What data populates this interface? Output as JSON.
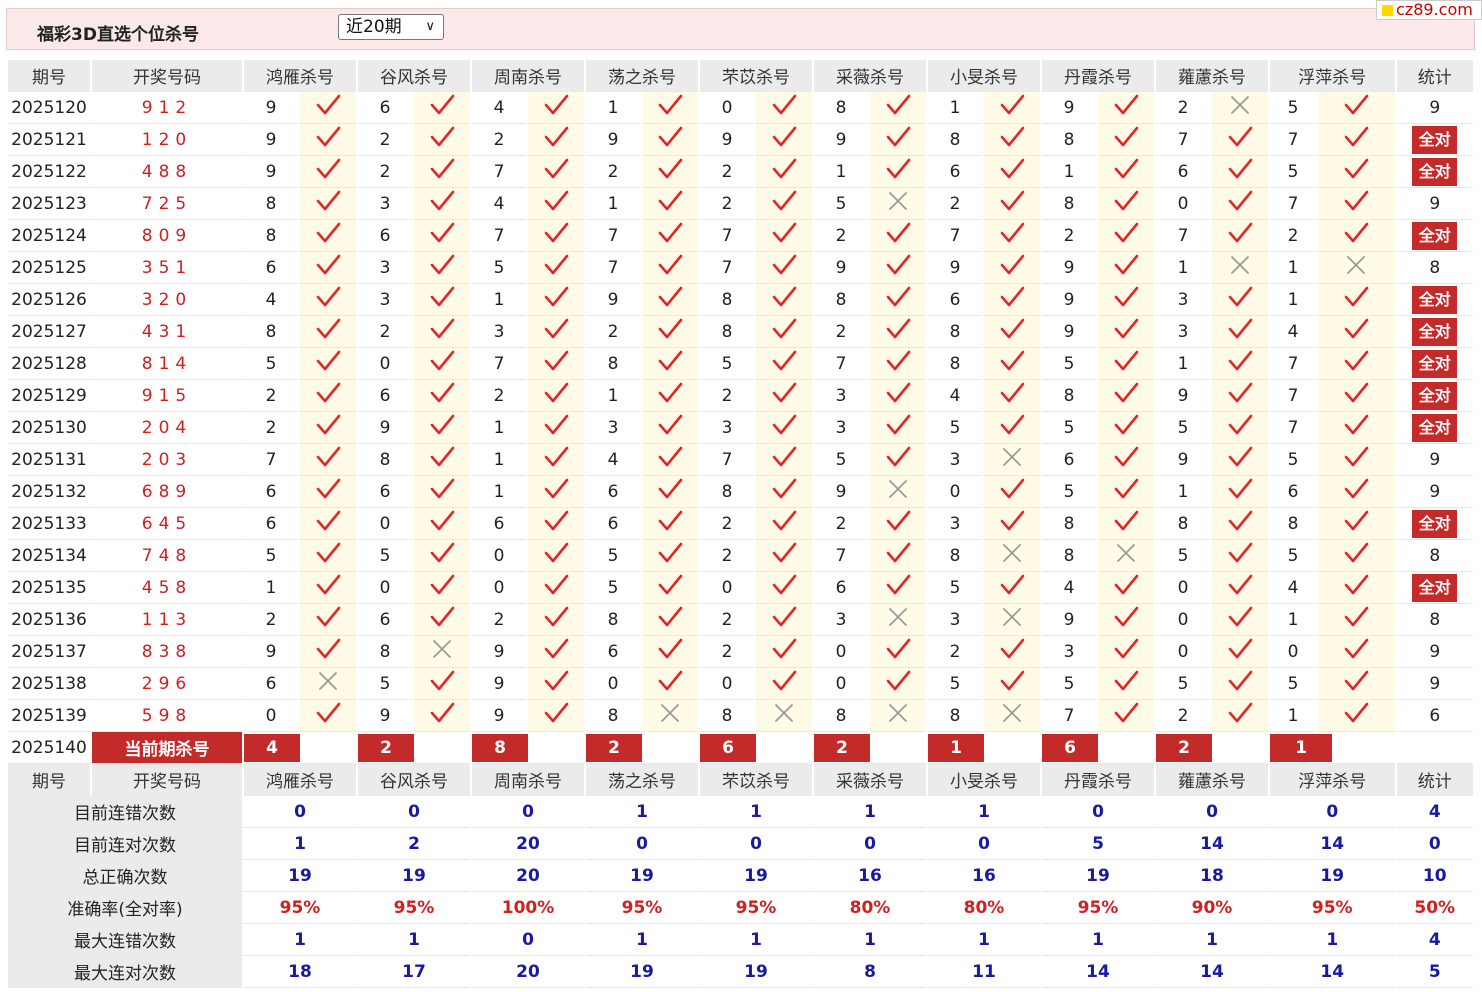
{
  "title": "福彩3D直选个位杀号",
  "range_select": {
    "value": "近20期"
  },
  "brand": "cz89.com",
  "headers": {
    "period": "期号",
    "draw": "开奖号码",
    "total": "统计",
    "experts": [
      "鸿雁杀号",
      "谷风杀号",
      "周南杀号",
      "荡之杀号",
      "芣苡杀号",
      "采薇杀号",
      "小旻杀号",
      "丹霞杀号",
      "蕹藘杀号",
      "浮萍杀号"
    ]
  },
  "all_right_label": "全对",
  "rows": [
    {
      "period": "2025120",
      "draw": "912",
      "kills": [
        9,
        6,
        4,
        1,
        0,
        8,
        1,
        9,
        2,
        5
      ],
      "ok": [
        1,
        1,
        1,
        1,
        1,
        1,
        1,
        1,
        0,
        1
      ],
      "total": "9"
    },
    {
      "period": "2025121",
      "draw": "120",
      "kills": [
        9,
        2,
        2,
        9,
        9,
        9,
        8,
        8,
        7,
        7
      ],
      "ok": [
        1,
        1,
        1,
        1,
        1,
        1,
        1,
        1,
        1,
        1
      ],
      "total": "全对"
    },
    {
      "period": "2025122",
      "draw": "488",
      "kills": [
        9,
        2,
        7,
        2,
        2,
        1,
        6,
        1,
        6,
        5
      ],
      "ok": [
        1,
        1,
        1,
        1,
        1,
        1,
        1,
        1,
        1,
        1
      ],
      "total": "全对"
    },
    {
      "period": "2025123",
      "draw": "725",
      "kills": [
        8,
        3,
        4,
        1,
        2,
        5,
        2,
        8,
        0,
        7
      ],
      "ok": [
        1,
        1,
        1,
        1,
        1,
        0,
        1,
        1,
        1,
        1
      ],
      "total": "9"
    },
    {
      "period": "2025124",
      "draw": "809",
      "kills": [
        8,
        6,
        7,
        7,
        7,
        2,
        7,
        2,
        7,
        2
      ],
      "ok": [
        1,
        1,
        1,
        1,
        1,
        1,
        1,
        1,
        1,
        1
      ],
      "total": "全对"
    },
    {
      "period": "2025125",
      "draw": "351",
      "kills": [
        6,
        3,
        5,
        7,
        7,
        9,
        9,
        9,
        1,
        1
      ],
      "ok": [
        1,
        1,
        1,
        1,
        1,
        1,
        1,
        1,
        0,
        0
      ],
      "total": "8"
    },
    {
      "period": "2025126",
      "draw": "320",
      "kills": [
        4,
        3,
        1,
        9,
        8,
        8,
        6,
        9,
        3,
        1
      ],
      "ok": [
        1,
        1,
        1,
        1,
        1,
        1,
        1,
        1,
        1,
        1
      ],
      "total": "全对"
    },
    {
      "period": "2025127",
      "draw": "431",
      "kills": [
        8,
        2,
        3,
        2,
        8,
        2,
        8,
        9,
        3,
        4
      ],
      "ok": [
        1,
        1,
        1,
        1,
        1,
        1,
        1,
        1,
        1,
        1
      ],
      "total": "全对"
    },
    {
      "period": "2025128",
      "draw": "814",
      "kills": [
        5,
        0,
        7,
        8,
        5,
        7,
        8,
        5,
        1,
        7
      ],
      "ok": [
        1,
        1,
        1,
        1,
        1,
        1,
        1,
        1,
        1,
        1
      ],
      "total": "全对"
    },
    {
      "period": "2025129",
      "draw": "915",
      "kills": [
        2,
        6,
        2,
        1,
        2,
        3,
        4,
        8,
        9,
        7
      ],
      "ok": [
        1,
        1,
        1,
        1,
        1,
        1,
        1,
        1,
        1,
        1
      ],
      "total": "全对"
    },
    {
      "period": "2025130",
      "draw": "204",
      "kills": [
        2,
        9,
        1,
        3,
        3,
        3,
        5,
        5,
        5,
        7
      ],
      "ok": [
        1,
        1,
        1,
        1,
        1,
        1,
        1,
        1,
        1,
        1
      ],
      "total": "全对"
    },
    {
      "period": "2025131",
      "draw": "203",
      "kills": [
        7,
        8,
        1,
        4,
        7,
        5,
        3,
        6,
        9,
        5
      ],
      "ok": [
        1,
        1,
        1,
        1,
        1,
        1,
        0,
        1,
        1,
        1
      ],
      "total": "9"
    },
    {
      "period": "2025132",
      "draw": "689",
      "kills": [
        6,
        6,
        1,
        6,
        8,
        9,
        0,
        5,
        1,
        6
      ],
      "ok": [
        1,
        1,
        1,
        1,
        1,
        0,
        1,
        1,
        1,
        1
      ],
      "total": "9"
    },
    {
      "period": "2025133",
      "draw": "645",
      "kills": [
        6,
        0,
        6,
        6,
        2,
        2,
        3,
        8,
        8,
        8
      ],
      "ok": [
        1,
        1,
        1,
        1,
        1,
        1,
        1,
        1,
        1,
        1
      ],
      "total": "全对"
    },
    {
      "period": "2025134",
      "draw": "748",
      "kills": [
        5,
        5,
        0,
        5,
        2,
        7,
        8,
        8,
        5,
        5
      ],
      "ok": [
        1,
        1,
        1,
        1,
        1,
        1,
        0,
        0,
        1,
        1
      ],
      "total": "8"
    },
    {
      "period": "2025135",
      "draw": "458",
      "kills": [
        1,
        0,
        0,
        5,
        0,
        6,
        5,
        4,
        0,
        4
      ],
      "ok": [
        1,
        1,
        1,
        1,
        1,
        1,
        1,
        1,
        1,
        1
      ],
      "total": "全对"
    },
    {
      "period": "2025136",
      "draw": "113",
      "kills": [
        2,
        6,
        2,
        8,
        2,
        3,
        3,
        9,
        0,
        1
      ],
      "ok": [
        1,
        1,
        1,
        1,
        1,
        0,
        0,
        1,
        1,
        1
      ],
      "total": "8"
    },
    {
      "period": "2025137",
      "draw": "838",
      "kills": [
        9,
        8,
        9,
        6,
        2,
        0,
        2,
        3,
        0,
        0
      ],
      "ok": [
        1,
        0,
        1,
        1,
        1,
        1,
        1,
        1,
        1,
        1
      ],
      "total": "9"
    },
    {
      "period": "2025138",
      "draw": "296",
      "kills": [
        6,
        5,
        9,
        0,
        0,
        0,
        5,
        5,
        5,
        5
      ],
      "ok": [
        0,
        1,
        1,
        1,
        1,
        1,
        1,
        1,
        1,
        1
      ],
      "total": "9"
    },
    {
      "period": "2025139",
      "draw": "598",
      "kills": [
        0,
        9,
        9,
        8,
        8,
        8,
        8,
        7,
        2,
        1
      ],
      "ok": [
        1,
        1,
        1,
        0,
        0,
        0,
        0,
        1,
        1,
        1
      ],
      "total": "6"
    }
  ],
  "current": {
    "period": "2025140",
    "label": "当前期杀号",
    "kills": [
      "4",
      "2",
      "8",
      "2",
      "6",
      "2",
      "1",
      "6",
      "2",
      "1"
    ]
  },
  "stats": [
    {
      "label": "目前连错次数",
      "values": [
        "0",
        "0",
        "0",
        "1",
        "1",
        "1",
        "1",
        "0",
        "0",
        "0"
      ],
      "total": "4"
    },
    {
      "label": "目前连对次数",
      "values": [
        "1",
        "2",
        "20",
        "0",
        "0",
        "0",
        "0",
        "5",
        "14",
        "14"
      ],
      "total": "0"
    },
    {
      "label": "总正确次数",
      "values": [
        "19",
        "19",
        "20",
        "19",
        "19",
        "16",
        "16",
        "19",
        "18",
        "19"
      ],
      "total": "10"
    },
    {
      "label": "准确率(全对率)",
      "values": [
        "95%",
        "95%",
        "100%",
        "95%",
        "95%",
        "80%",
        "80%",
        "95%",
        "90%",
        "95%"
      ],
      "total": "50%",
      "pct": true
    },
    {
      "label": "最大连错次数",
      "values": [
        "1",
        "1",
        "0",
        "1",
        "1",
        "1",
        "1",
        "1",
        "1",
        "1"
      ],
      "total": "4"
    },
    {
      "label": "最大连对次数",
      "values": [
        "18",
        "17",
        "20",
        "19",
        "19",
        "8",
        "11",
        "14",
        "14",
        "14"
      ],
      "total": "5"
    }
  ],
  "colors": {
    "accent_red": "#c32a2a",
    "check_red": "#e0262a",
    "cross_gray": "#9a9a9a",
    "stat_blue": "#1a1aa0",
    "pale_yellow": "#fffbe6"
  },
  "icons": {
    "correct": "check-icon",
    "wrong": "cross-icon"
  }
}
